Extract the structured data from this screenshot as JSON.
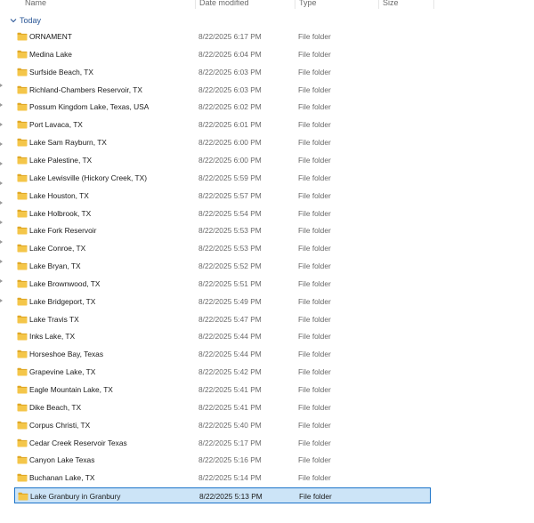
{
  "columns": {
    "name": "Name",
    "date_modified": "Date modified",
    "type": "Type",
    "size": "Size"
  },
  "group": {
    "label": "Today",
    "icon": "chevron-down-icon"
  },
  "colors": {
    "folder": "#f4c64a",
    "selection_bg": "#cce4f7",
    "selection_border": "#1a73c9",
    "group_text": "#2b5797"
  },
  "selected_item": "Lake Granbury in Granbury",
  "files": [
    {
      "name": "ORNAMENT",
      "date": "8/22/2025 6:17 PM",
      "type": "File folder",
      "size": ""
    },
    {
      "name": "Medina Lake",
      "date": "8/22/2025 6:04 PM",
      "type": "File folder",
      "size": ""
    },
    {
      "name": "Surfside Beach, TX",
      "date": "8/22/2025 6:03 PM",
      "type": "File folder",
      "size": ""
    },
    {
      "name": "Richland-Chambers Reservoir, TX",
      "date": "8/22/2025 6:03 PM",
      "type": "File folder",
      "size": ""
    },
    {
      "name": "Possum Kingdom Lake, Texas, USA",
      "date": "8/22/2025 6:02 PM",
      "type": "File folder",
      "size": ""
    },
    {
      "name": "Port Lavaca, TX",
      "date": "8/22/2025 6:01 PM",
      "type": "File folder",
      "size": ""
    },
    {
      "name": "Lake Sam Rayburn, TX",
      "date": "8/22/2025 6:00 PM",
      "type": "File folder",
      "size": ""
    },
    {
      "name": "Lake Palestine, TX",
      "date": "8/22/2025 6:00 PM",
      "type": "File folder",
      "size": ""
    },
    {
      "name": "Lake Lewisville (Hickory Creek, TX)",
      "date": "8/22/2025 5:59 PM",
      "type": "File folder",
      "size": ""
    },
    {
      "name": "Lake Houston, TX",
      "date": "8/22/2025 5:57 PM",
      "type": "File folder",
      "size": ""
    },
    {
      "name": "Lake Holbrook, TX",
      "date": "8/22/2025 5:54 PM",
      "type": "File folder",
      "size": ""
    },
    {
      "name": "Lake Fork Reservoir",
      "date": "8/22/2025 5:53 PM",
      "type": "File folder",
      "size": ""
    },
    {
      "name": "Lake Conroe, TX",
      "date": "8/22/2025 5:53 PM",
      "type": "File folder",
      "size": ""
    },
    {
      "name": "Lake Bryan, TX",
      "date": "8/22/2025 5:52 PM",
      "type": "File folder",
      "size": ""
    },
    {
      "name": "Lake Brownwood, TX",
      "date": "8/22/2025 5:51 PM",
      "type": "File folder",
      "size": ""
    },
    {
      "name": "Lake Bridgeport, TX",
      "date": "8/22/2025 5:49 PM",
      "type": "File folder",
      "size": ""
    },
    {
      "name": "Lake Travis TX",
      "date": "8/22/2025 5:47 PM",
      "type": "File folder",
      "size": ""
    },
    {
      "name": "Inks Lake, TX",
      "date": "8/22/2025 5:44 PM",
      "type": "File folder",
      "size": ""
    },
    {
      "name": "Horseshoe Bay, Texas",
      "date": "8/22/2025 5:44 PM",
      "type": "File folder",
      "size": ""
    },
    {
      "name": "Grapevine Lake, TX",
      "date": "8/22/2025 5:42 PM",
      "type": "File folder",
      "size": ""
    },
    {
      "name": "Eagle Mountain Lake, TX",
      "date": "8/22/2025 5:41 PM",
      "type": "File folder",
      "size": ""
    },
    {
      "name": "Dike Beach, TX",
      "date": "8/22/2025 5:41 PM",
      "type": "File folder",
      "size": ""
    },
    {
      "name": "Corpus Christi, TX",
      "date": "8/22/2025 5:40 PM",
      "type": "File folder",
      "size": ""
    },
    {
      "name": "Cedar Creek Reservoir Texas",
      "date": "8/22/2025 5:17 PM",
      "type": "File folder",
      "size": ""
    },
    {
      "name": "Canyon Lake Texas",
      "date": "8/22/2025 5:16 PM",
      "type": "File folder",
      "size": ""
    },
    {
      "name": "Buchanan Lake, TX",
      "date": "8/22/2025 5:14 PM",
      "type": "File folder",
      "size": ""
    },
    {
      "name": "Lake Granbury in Granbury",
      "date": "8/22/2025 5:13 PM",
      "type": "File folder",
      "size": ""
    }
  ]
}
